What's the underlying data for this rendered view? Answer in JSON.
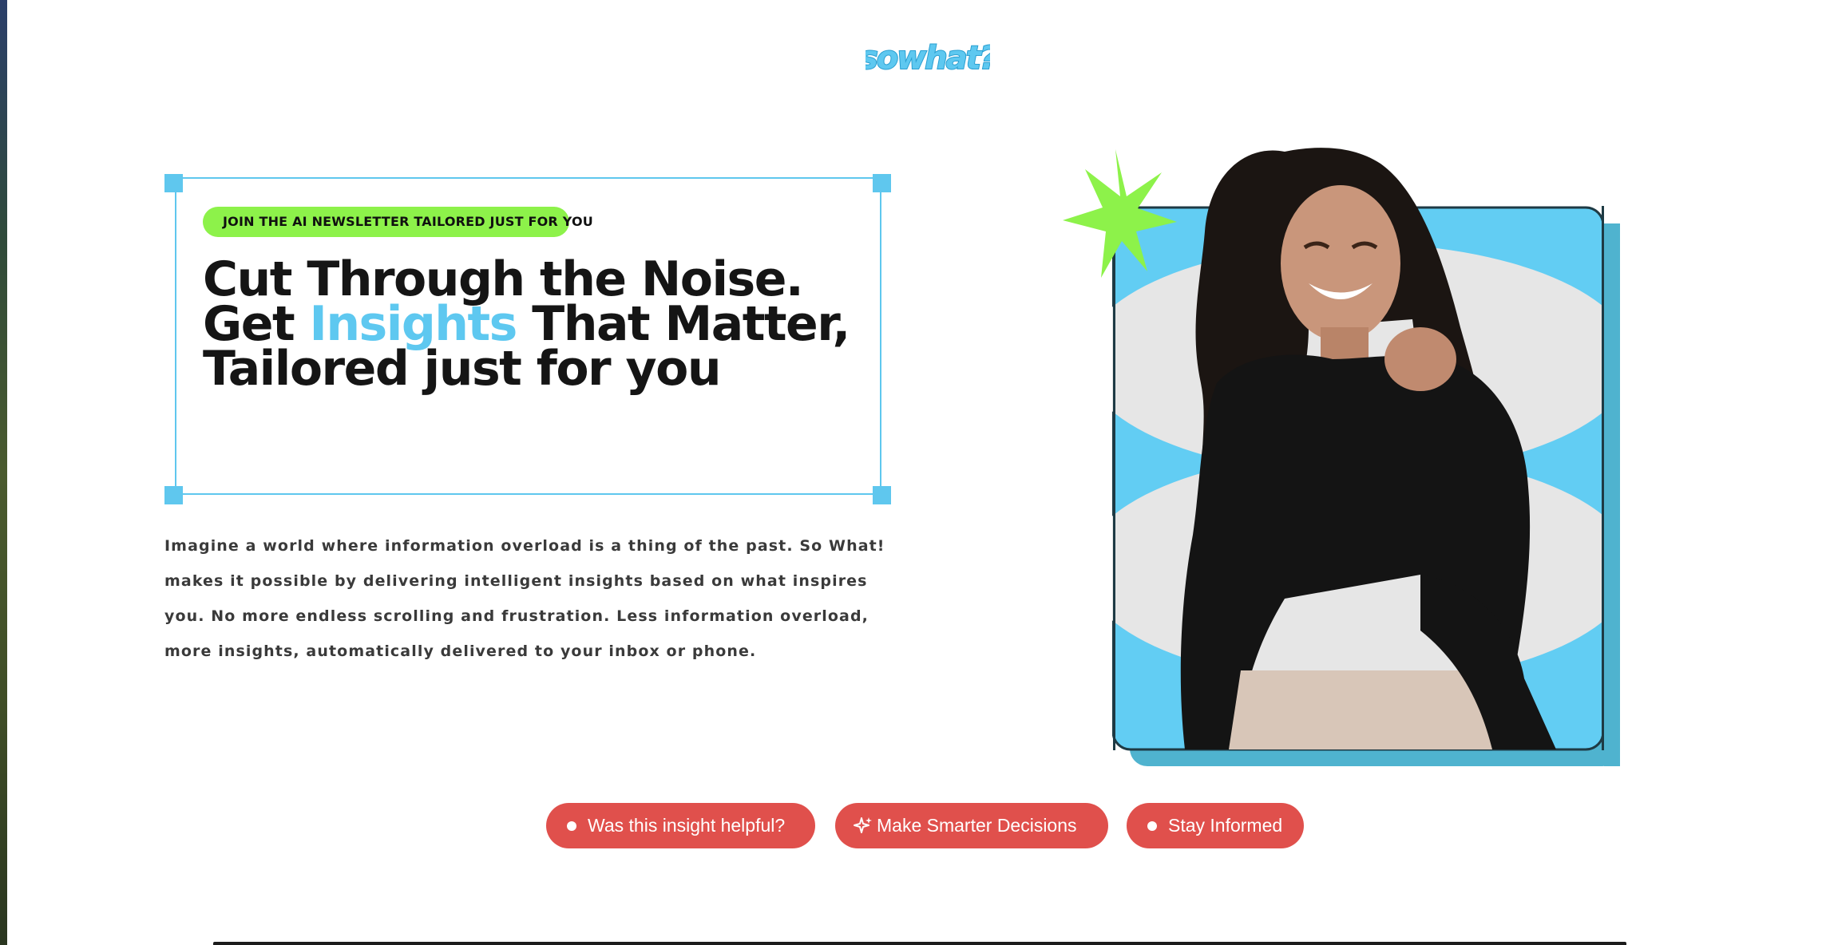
{
  "brand": {
    "logo_text": "sowhat?"
  },
  "hero": {
    "tagline": "JOIN THE AI NEWSLETTER TAILORED JUST FOR YOU",
    "headline_before": "Cut Through the Noise. Get ",
    "headline_highlight": "Insights",
    "headline_after": " That Matter, Tailored just for you",
    "intro": "Imagine a world where information overload is a thing of the past. So What! makes it possible by delivering intelligent insights based on what inspires you. No more endless scrolling and frustration. Less information overload, more insights, automatically delivered to your inbox or phone."
  },
  "actions": [
    {
      "label": "Was this insight helpful?",
      "icon": "dot-icon"
    },
    {
      "label": "Make Smarter Decisions",
      "icon": "sparkle-icon"
    },
    {
      "label": "Stay Informed",
      "icon": "dot-icon"
    }
  ],
  "colors": {
    "accent_blue": "#5ec8f0",
    "accent_green": "#8df24a",
    "pill_red": "#e0504c",
    "ink": "#151515"
  }
}
